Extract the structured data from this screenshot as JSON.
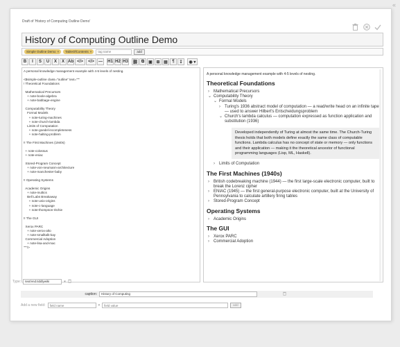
{
  "collapse_glyph": "«",
  "draft_title": "Draft of 'History of Computing Outline Demo'",
  "title_value": "History of Computing Outline Demo",
  "tags": [
    {
      "label": "Simple Outline Demo"
    },
    {
      "label": "TableOfContents"
    }
  ],
  "tag_remove": "×",
  "tag_input_placeholder": "tag name",
  "tag_add_label": "add",
  "toolbar_buttons": [
    "B",
    "I",
    "S",
    "U",
    "X",
    "X",
    "Ab",
    "</>",
    "</>",
    "—",
    "H1",
    "H2",
    "H3",
    "⛓",
    "⧉",
    "▣",
    "⊞",
    "▤",
    "¶",
    "↧",
    "◉ ▾"
  ],
  "editor_text": "A personal knowledge management example with 4-5 levels of nesting.\n\n<$simple-outline class=\"outline\" text=\"\"\"\n! Theoretical Foundations\n\n  Mathematical Precursors\n    + note-boole-algebra\n    + note-babbage-engine\n\n  Computability Theory\n    Formal Models\n      + note-turing-machines\n      + note-church-lambda\n    Limits of Computation\n      + note-goedel-incompleteness\n      + note-halting-problem\n\n!! The First Machines (1940s)\n\n  + note-colossus\n  + note-eniac\n\n  Stored-Program Concept\n    + note-von-neumann-architecture\n    + note-manchester-baby\n\n!! Operating Systems\n\n  Academic Origins\n    + note-multics\n    Bell Labs Breakaway\n      + note-unix-origins\n      + note-c-language\n      + note-thompson-ritchie\n\n!! The GUI\n\n  Xerox PARC\n    + note-xerox-alto\n    + note-smalltalk-kay\n  Commercial Adoption\n    + note-lisa-and-mac\n\"\"\"/>",
  "preview": {
    "intro": "A personal knowledge management example with 4-5 levels of nesting.",
    "sections": [
      {
        "heading": "Theoretical Foundations",
        "items": [
          {
            "level": 1,
            "chev": "›",
            "text": "Mathematical Precursors"
          },
          {
            "level": 1,
            "chev": "⌄",
            "text": "Computability Theory"
          },
          {
            "level": 2,
            "chev": "⌄",
            "text": "Formal Models"
          },
          {
            "level": 3,
            "chev": "›",
            "text": "Turing's 1936 abstract model of computation — a read/write head on an infinite tape — used to answer Hilbert's Entscheidungsproblem"
          },
          {
            "level": 3,
            "chev": "⌄",
            "text": "Church's lambda calculus — computation expressed as function application and substitution (1936)"
          },
          {
            "level": 4,
            "quote": "Developed independently of Turing at almost the same time. The Church-Turing thesis holds that both models define exactly the same class of computable functions. Lambda calculus has no concept of state or memory — only functions and their application — making it the theoretical ancestor of functional programming languages (Lisp, ML, Haskell)."
          },
          {
            "level": 2,
            "chev": "›",
            "text": "Limits of Computation"
          }
        ]
      },
      {
        "heading": "The First Machines (1940s)",
        "items": [
          {
            "level": 1,
            "chev": "›",
            "text": "British codebreaking machine (1944) — the first large-scale electronic computer, built to break the Lorenz cipher"
          },
          {
            "level": 1,
            "chev": "›",
            "text": "ENIAC (1945) — the first general-purpose electronic computer, built at the University of Pennsylvania to calculate artillery firing tables"
          },
          {
            "level": 1,
            "chev": "›",
            "text": "Stored-Program Concept"
          }
        ]
      },
      {
        "heading": "Operating Systems",
        "items": [
          {
            "level": 1,
            "chev": "›",
            "text": "Academic Origins"
          }
        ]
      },
      {
        "heading": "The GUI",
        "items": [
          {
            "level": 1,
            "chev": "›",
            "text": "Xerox PARC"
          },
          {
            "level": 1,
            "chev": "›",
            "text": "Commercial Adoption"
          }
        ]
      }
    ]
  },
  "type_label": "Type:",
  "type_value": "text/vnd.tiddlywiki",
  "type_dropdown_glyph": "▾",
  "caption_label": "caption:",
  "caption_value": "History of Computing",
  "new_field_label": "Add a new field:",
  "new_field_name_placeholder": "field name",
  "new_field_value_placeholder": "field value",
  "new_field_add_label": "add",
  "colors": {
    "tag_pill": "#e6c86e",
    "background": "#ececec",
    "quote_bg": "#eeeeee"
  }
}
